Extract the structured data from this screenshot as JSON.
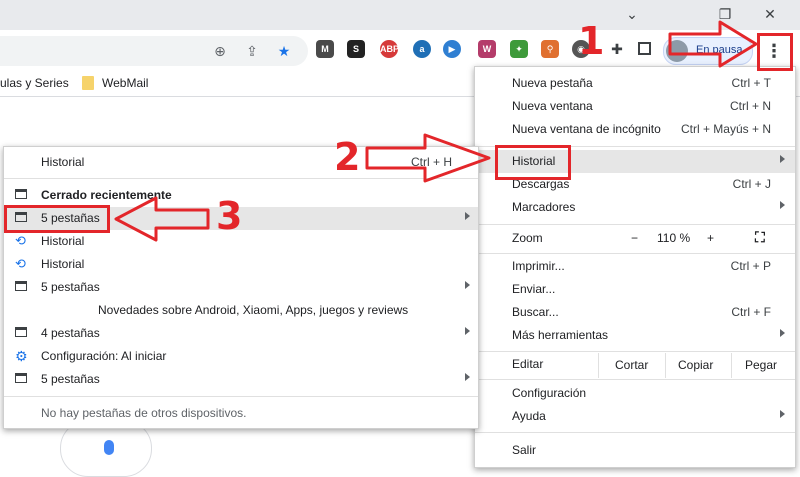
{
  "window": {
    "minimize": "⌄",
    "restore": "❐",
    "close": "✕"
  },
  "bookmarks": {
    "partial_item": "ulas y Series",
    "webmail": "WebMail"
  },
  "extensions": [
    {
      "name": "M-ext-icon",
      "label": "M",
      "color": "#4a4a4a"
    },
    {
      "name": "s-ext-icon",
      "label": "S",
      "color": "#222222"
    },
    {
      "name": "abp-ext-icon",
      "label": "ABP",
      "color": "#d63a3a"
    },
    {
      "name": "a-ext-icon",
      "label": "a",
      "color": "#1f6fb6"
    },
    {
      "name": "play-ext-icon",
      "label": "▶",
      "color": "#2f7fd2"
    },
    {
      "name": "w-ext-icon",
      "label": "W",
      "color": "#b43c6a"
    },
    {
      "name": "puzzle-green-ext-icon",
      "label": "✦",
      "color": "#3e9a3a"
    },
    {
      "name": "lock-ext-icon",
      "label": "⚲",
      "color": "#e07030"
    },
    {
      "name": "circle-ext-icon",
      "label": "◉",
      "color": "#555555"
    }
  ],
  "profile": {
    "label": "En pausa"
  },
  "main_menu": {
    "items": [
      {
        "label": "Nueva pestaña",
        "shortcut": "Ctrl + T"
      },
      {
        "label": "Nueva ventana",
        "shortcut": "Ctrl + N"
      },
      {
        "label": "Nueva ventana de incógnito",
        "shortcut": "Ctrl + Mayús + N"
      },
      {
        "label": "Historial",
        "shortcut": ""
      },
      {
        "label": "Descargas",
        "shortcut": "Ctrl + J"
      },
      {
        "label": "Marcadores",
        "shortcut": ""
      },
      {
        "label": "Imprimir...",
        "shortcut": "Ctrl + P"
      },
      {
        "label": "Enviar...",
        "shortcut": ""
      },
      {
        "label": "Buscar...",
        "shortcut": "Ctrl + F"
      },
      {
        "label": "Más herramientas",
        "shortcut": ""
      },
      {
        "label": "Configuración",
        "shortcut": ""
      },
      {
        "label": "Ayuda",
        "shortcut": ""
      },
      {
        "label": "Salir",
        "shortcut": ""
      }
    ],
    "zoom": {
      "label": "Zoom",
      "minus": "−",
      "value": "110 %",
      "plus": "+",
      "fullscreen": "⛶"
    },
    "edit": {
      "label": "Editar",
      "cut": "Cortar",
      "copy": "Copiar",
      "paste": "Pegar"
    }
  },
  "history_menu": {
    "header": {
      "label": "Historial",
      "shortcut": "Ctrl + H"
    },
    "recent_title": "Cerrado recientemente",
    "items": [
      {
        "label": "5 pestañas"
      },
      {
        "label": "Historial"
      },
      {
        "label": "Historial"
      },
      {
        "label": "5 pestañas"
      },
      {
        "label": "Novedades sobre Android, Xiaomi, Apps, juegos y reviews"
      },
      {
        "label": "4 pestañas"
      },
      {
        "label": "Configuración: Al iniciar"
      },
      {
        "label": "5 pestañas"
      }
    ],
    "footer": "No hay pestañas de otros dispositivos."
  },
  "annotations": {
    "step1": "1",
    "step2": "2",
    "step3": "3",
    "accent": "#e3262a"
  }
}
